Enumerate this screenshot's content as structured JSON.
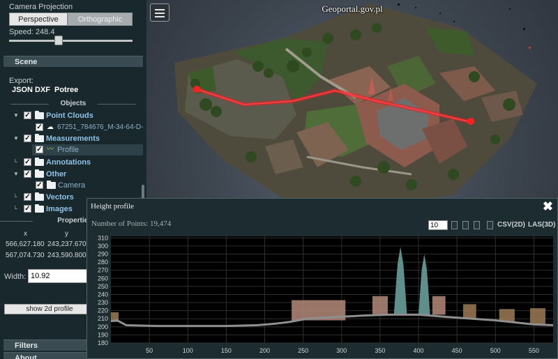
{
  "viewport": {
    "title": "Geoportal.gov.pl",
    "menu_icon": "hamburger-menu-icon"
  },
  "sidebar": {
    "camera_projection_label": "Camera Projection",
    "projection_buttons": [
      "Perspective",
      "Orthographic"
    ],
    "active_projection": "Perspective",
    "speed_label": "Speed: 248.4",
    "speed_level": 0.38,
    "scene_header": "Scene",
    "export_label": "Export:",
    "export_links": [
      "JSON",
      "DXF",
      "Potree"
    ],
    "objects_title": "Objects",
    "tree": [
      {
        "label": "Point Clouds",
        "icon": "folder-icon"
      },
      {
        "label": "67251_784676_M-34-64-D-",
        "icon": "cloud-icon"
      },
      {
        "label": "Measurements",
        "icon": "folder-icon"
      },
      {
        "label": "Profile",
        "icon": "profile-icon"
      },
      {
        "label": "Annotations",
        "icon": "folder-icon"
      },
      {
        "label": "Other",
        "icon": "folder-icon"
      },
      {
        "label": "Camera",
        "icon": "folder-icon"
      },
      {
        "label": "Vectors",
        "icon": "folder-icon"
      },
      {
        "label": "Images",
        "icon": "folder-icon"
      }
    ],
    "properties_title": "Properties",
    "coord_headers": [
      "x",
      "y"
    ],
    "coord_rows": [
      [
        "566,627.180",
        "243,237.670"
      ],
      [
        "567,074.730",
        "243,590.800"
      ]
    ],
    "width_label": "Width:",
    "width_value": "10.92",
    "show2d_label": "show 2d profile",
    "filters_header": "Filters",
    "about_header": "About"
  },
  "height_profile": {
    "title": "Height profile",
    "points_label": "Number of Points:  19,474",
    "point_size_value": "10",
    "export_links": [
      "CSV(2D)",
      "LAS(3D)"
    ],
    "close_icon": "close-x-icon",
    "colors": {
      "background": "#000000",
      "grid": "#2f2f2f",
      "ground": "#8f8f8f"
    }
  },
  "chart_data": {
    "type": "scatter",
    "title": "",
    "xlabel": "",
    "ylabel": "",
    "xlim": [
      0,
      575
    ],
    "ylim": [
      180,
      312
    ],
    "x_ticks": [
      50,
      100,
      150,
      200,
      250,
      300,
      350,
      400,
      450,
      500,
      550
    ],
    "y_ticks": [
      180,
      190,
      200,
      210,
      220,
      230,
      240,
      250,
      260,
      270,
      280,
      290,
      300,
      310
    ],
    "grid": true,
    "ground_profile": [
      [
        0,
        207
      ],
      [
        8,
        208
      ],
      [
        20,
        202
      ],
      [
        60,
        201
      ],
      [
        100,
        201
      ],
      [
        150,
        201
      ],
      [
        190,
        202
      ],
      [
        215,
        204
      ],
      [
        232,
        206
      ],
      [
        255,
        210
      ],
      [
        290,
        212
      ],
      [
        330,
        214
      ],
      [
        360,
        215
      ],
      [
        400,
        215
      ],
      [
        440,
        212
      ],
      [
        470,
        210
      ],
      [
        500,
        208
      ],
      [
        520,
        206
      ],
      [
        550,
        203
      ],
      [
        575,
        202
      ]
    ],
    "features": [
      {
        "name": "tower",
        "x0": 368,
        "x1": 385,
        "top": 299,
        "base": 215
      },
      {
        "name": "tower",
        "x0": 400,
        "x1": 415,
        "top": 290,
        "base": 215
      },
      {
        "name": "building",
        "x0": 235,
        "x1": 305,
        "top": 233,
        "base": 208
      },
      {
        "name": "building",
        "x0": 340,
        "x1": 360,
        "top": 238,
        "base": 214
      },
      {
        "name": "building",
        "x0": 418,
        "x1": 435,
        "top": 238,
        "base": 215
      },
      {
        "name": "trees",
        "x0": 458,
        "x1": 475,
        "top": 228,
        "base": 211
      },
      {
        "name": "trees",
        "x0": 505,
        "x1": 525,
        "top": 222,
        "base": 206
      },
      {
        "name": "trees",
        "x0": 545,
        "x1": 565,
        "top": 223,
        "base": 203
      },
      {
        "name": "trees",
        "x0": 0,
        "x1": 10,
        "top": 218,
        "base": 206
      }
    ]
  }
}
